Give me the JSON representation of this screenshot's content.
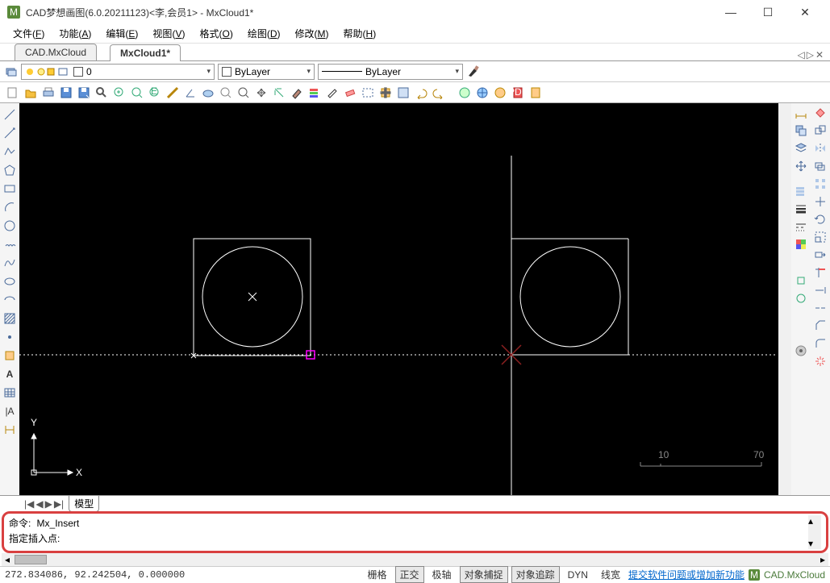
{
  "window": {
    "title": "CAD梦想画图(6.0.20211123)<李,会员1> - MxCloud1*"
  },
  "menubar": {
    "items": [
      {
        "label": "文件",
        "key": "F"
      },
      {
        "label": "功能",
        "key": "A"
      },
      {
        "label": "编辑",
        "key": "E"
      },
      {
        "label": "视图",
        "key": "V"
      },
      {
        "label": "格式",
        "key": "O"
      },
      {
        "label": "绘图",
        "key": "D"
      },
      {
        "label": "修改",
        "key": "M"
      },
      {
        "label": "帮助",
        "key": "H"
      }
    ]
  },
  "tabs": {
    "items": [
      {
        "label": "CAD.MxCloud",
        "active": false
      },
      {
        "label": "MxCloud1*",
        "active": true
      }
    ],
    "nav": {
      "left": "◁",
      "right": "▷",
      "close": "✕"
    }
  },
  "props": {
    "layer_value": "0",
    "color_value": "ByLayer",
    "ltype_value": "ByLayer"
  },
  "left_tools": {
    "items": [
      "line",
      "xline",
      "pline",
      "polygon",
      "rect",
      "arc",
      "circle",
      "revcloud",
      "spline",
      "ellipse",
      "earc",
      "hatch",
      "point",
      "block",
      "text",
      "table",
      "vtext",
      "dimension"
    ],
    "glyphs": [
      "/",
      "↗",
      "⟋",
      "⬠",
      "▭",
      "⌒",
      "⊙",
      "☁",
      "∿",
      "⬭",
      "◗",
      "▦",
      "•",
      "▣",
      "A",
      "▤",
      "|A",
      "⟊"
    ]
  },
  "right_tools_a": {
    "items": [
      "dim-linear",
      "dim-aligned",
      "dim-arc",
      "dim-radius",
      "dim-diameter",
      "dim-angular",
      "dim-leader",
      "tolerance",
      "center",
      "ordinate",
      "dim-edit",
      "dim-text",
      "dim-style"
    ],
    "glyphs": [
      "⊢⊣",
      "⤢",
      "⌒̄",
      "⊘",
      "⌀",
      "∡",
      "↙",
      "⊞",
      "⊕",
      "⊥",
      "✎",
      "Aᵢ",
      "✎A"
    ]
  },
  "right_tools_b": {
    "items": [
      "erase",
      "copy",
      "mirror",
      "offset",
      "array",
      "move",
      "rotate",
      "scale",
      "stretch",
      "trim",
      "extend",
      "break",
      "chamfer",
      "fillet",
      "explode"
    ],
    "glyphs": [
      "⌫",
      "⎘",
      "▟▙",
      "⇶",
      "▦",
      "✥",
      "↻",
      "◱",
      "⤡",
      "✂",
      "⎯",
      "⊟",
      "◢",
      "⌒",
      "✧"
    ]
  },
  "std_toolbar": {
    "items": [
      "new",
      "open",
      "print",
      "save",
      "saveas",
      "find",
      "zoom-win",
      "zoom-all",
      "zoom-ext",
      "measure",
      "angle",
      "cloud",
      "query",
      "pan",
      "regen",
      "layer",
      "line-panel",
      "match",
      "paint",
      "selprev",
      "insert",
      "pdf",
      "undo",
      "redo",
      "render",
      "world",
      "browser",
      "help",
      "info"
    ]
  },
  "canvas": {
    "ucs_x": "X",
    "ucs_y": "Y",
    "scale_a": "10",
    "scale_b": "70"
  },
  "modelspace": {
    "tab_label": "模型",
    "arrows": {
      "first": "|◀",
      "prev": "◀",
      "next": "▶",
      "last": "▶|"
    }
  },
  "command": {
    "line1_label": "命令:",
    "line1_value": "Mx_Insert",
    "line2_label": "指定插入点:",
    "line2_value": ""
  },
  "status": {
    "coords": "272.834086, 92.242504, 0.000000",
    "buttons": {
      "grid": "栅格",
      "ortho": "正交",
      "polar": "极轴",
      "osnap": "对象捕捉",
      "otrack": "对象追踪",
      "dyn": "DYN",
      "lwt": "线宽"
    },
    "feedback": "提交软件问题或增加新功能",
    "brand": "CAD.MxCloud"
  }
}
